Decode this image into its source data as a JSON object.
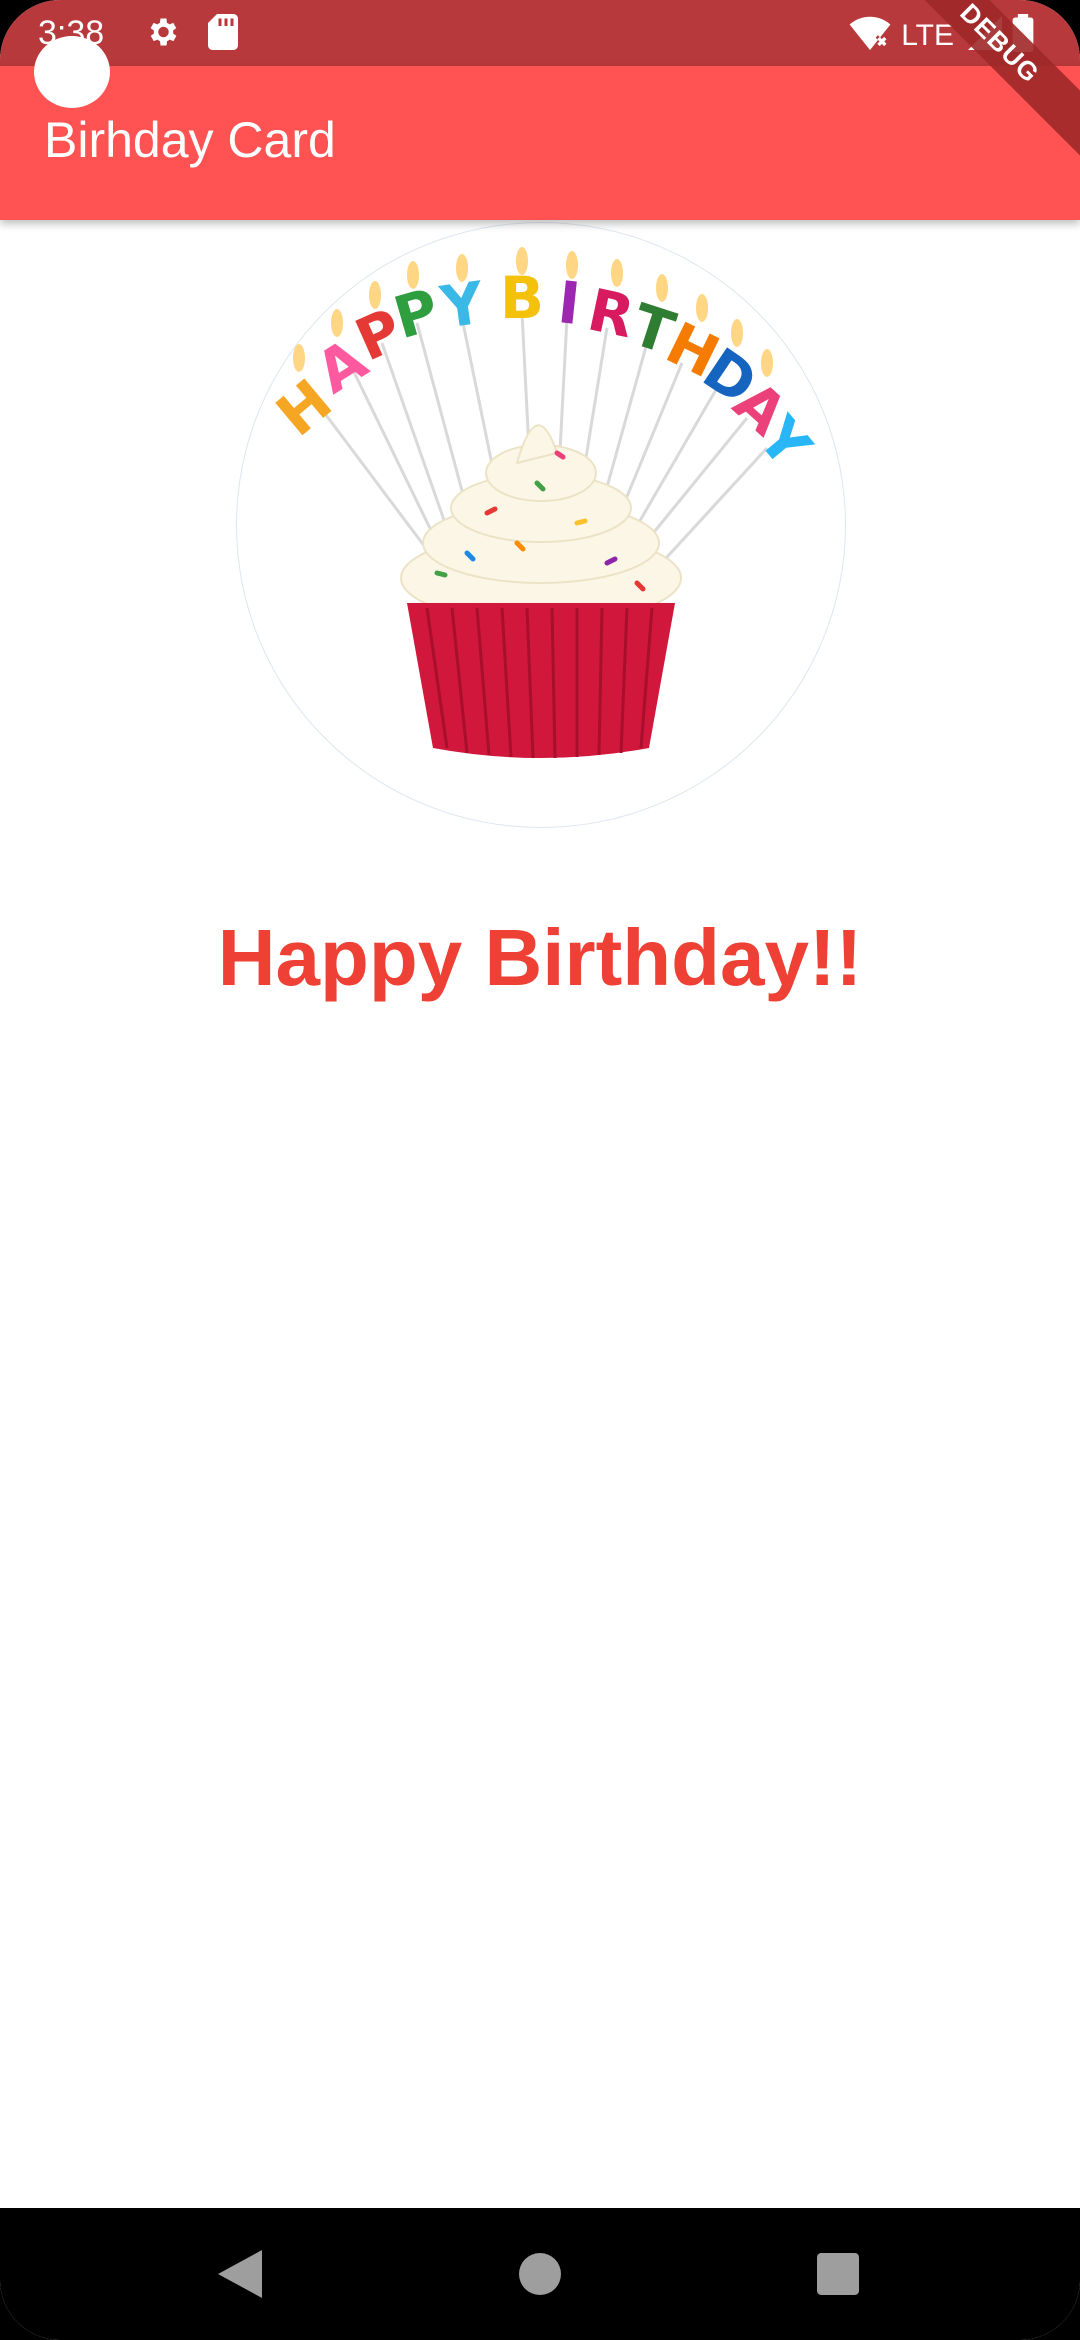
{
  "status_bar": {
    "time": "3:38",
    "network": "LTE",
    "icons_left": [
      "settings-gear-icon",
      "sd-card-icon"
    ],
    "icons_right": [
      "wifi-icon",
      "signal-icon",
      "battery-icon"
    ]
  },
  "app_bar": {
    "title": "Birhday Card",
    "background": "#ff5353"
  },
  "debug_banner": {
    "label": "DEBUG"
  },
  "content": {
    "image": {
      "candle_letters": [
        "H",
        "A",
        "P",
        "P",
        "Y",
        "B",
        "I",
        "R",
        "T",
        "H",
        "D",
        "A",
        "Y"
      ]
    },
    "headline": "Happy Birthday!!",
    "headline_color": "#ee4034"
  },
  "nav_bar": {
    "buttons": [
      "back-icon",
      "home-icon",
      "recents-icon"
    ]
  }
}
